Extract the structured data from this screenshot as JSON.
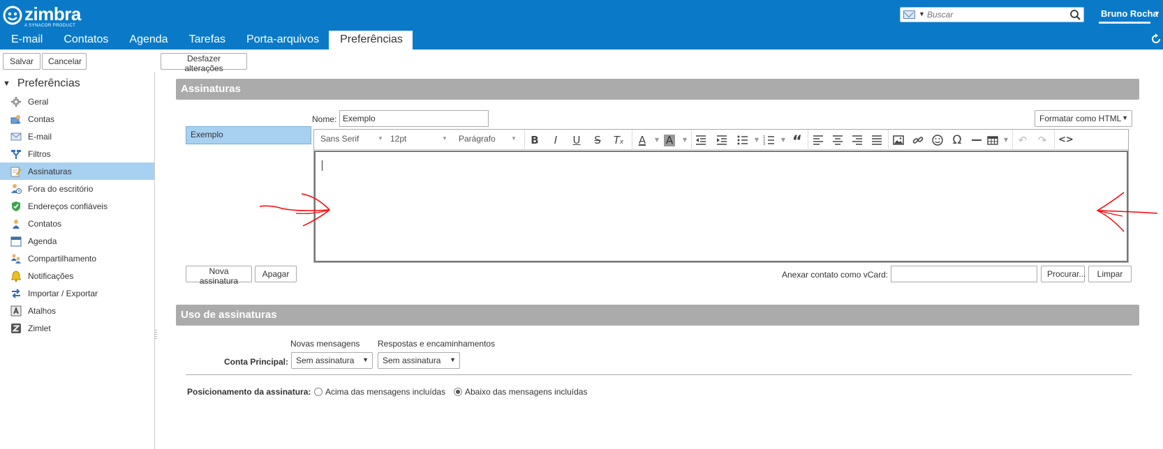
{
  "brand": {
    "name": "zimbra",
    "tagline": "A SYNACOR PRODUCT"
  },
  "search": {
    "placeholder": "Buscar"
  },
  "user": {
    "name": "Bruno Rocha"
  },
  "nav": {
    "tabs": [
      "E-mail",
      "Contatos",
      "Agenda",
      "Tarefas",
      "Porta-arquivos",
      "Preferências"
    ],
    "active": "Preferências"
  },
  "toolbar": {
    "save": "Salvar",
    "cancel": "Cancelar",
    "undo_changes": "Desfazer alterações"
  },
  "sidebar": {
    "header": "Preferências",
    "items": [
      {
        "label": "Geral",
        "icon": "gear-icon"
      },
      {
        "label": "Contas",
        "icon": "accounts-icon"
      },
      {
        "label": "E-mail",
        "icon": "mail-icon"
      },
      {
        "label": "Filtros",
        "icon": "filter-icon"
      },
      {
        "label": "Assinaturas",
        "icon": "signature-icon",
        "selected": true
      },
      {
        "label": "Fora do escritório",
        "icon": "out-of-office-icon"
      },
      {
        "label": "Endereços confiáveis",
        "icon": "shield-icon"
      },
      {
        "label": "Contatos",
        "icon": "contact-icon"
      },
      {
        "label": "Agenda",
        "icon": "calendar-icon"
      },
      {
        "label": "Compartilhamento",
        "icon": "sharing-icon"
      },
      {
        "label": "Notificações",
        "icon": "bell-icon"
      },
      {
        "label": "Importar / Exportar",
        "icon": "import-export-icon"
      },
      {
        "label": "Atalhos",
        "icon": "shortcut-icon"
      },
      {
        "label": "Zimlet",
        "icon": "zimlet-icon"
      }
    ]
  },
  "signatures": {
    "title": "Assinaturas",
    "list": [
      "Exemplo"
    ],
    "name_label": "Nome:",
    "name_value": "Exemplo",
    "format": "Formatar como HTML",
    "editor": {
      "font": "Sans Serif",
      "size": "12pt",
      "block": "Parágrafo"
    },
    "new_button": "Nova assinatura",
    "delete_button": "Apagar",
    "vcard_label": "Anexar contato como vCard:",
    "vcard_value": "",
    "browse_button": "Procurar...",
    "clear_button": "Limpar"
  },
  "usage": {
    "title": "Uso de assinaturas",
    "col_new": "Novas mensagens",
    "col_replies": "Respostas e encaminhamentos",
    "account_label": "Conta Principal:",
    "new_value": "Sem assinatura",
    "replies_value": "Sem assinatura",
    "position_label": "Posicionamento da assinatura:",
    "option_above": "Acima das mensagens incluídas",
    "option_below": "Abaixo das mensagens incluídas",
    "selected_option": "below"
  },
  "colors": {
    "topbar": "#0a7ac8",
    "selection": "#a8d1f1",
    "section": "#ababab",
    "annotation": "#ff0000"
  }
}
